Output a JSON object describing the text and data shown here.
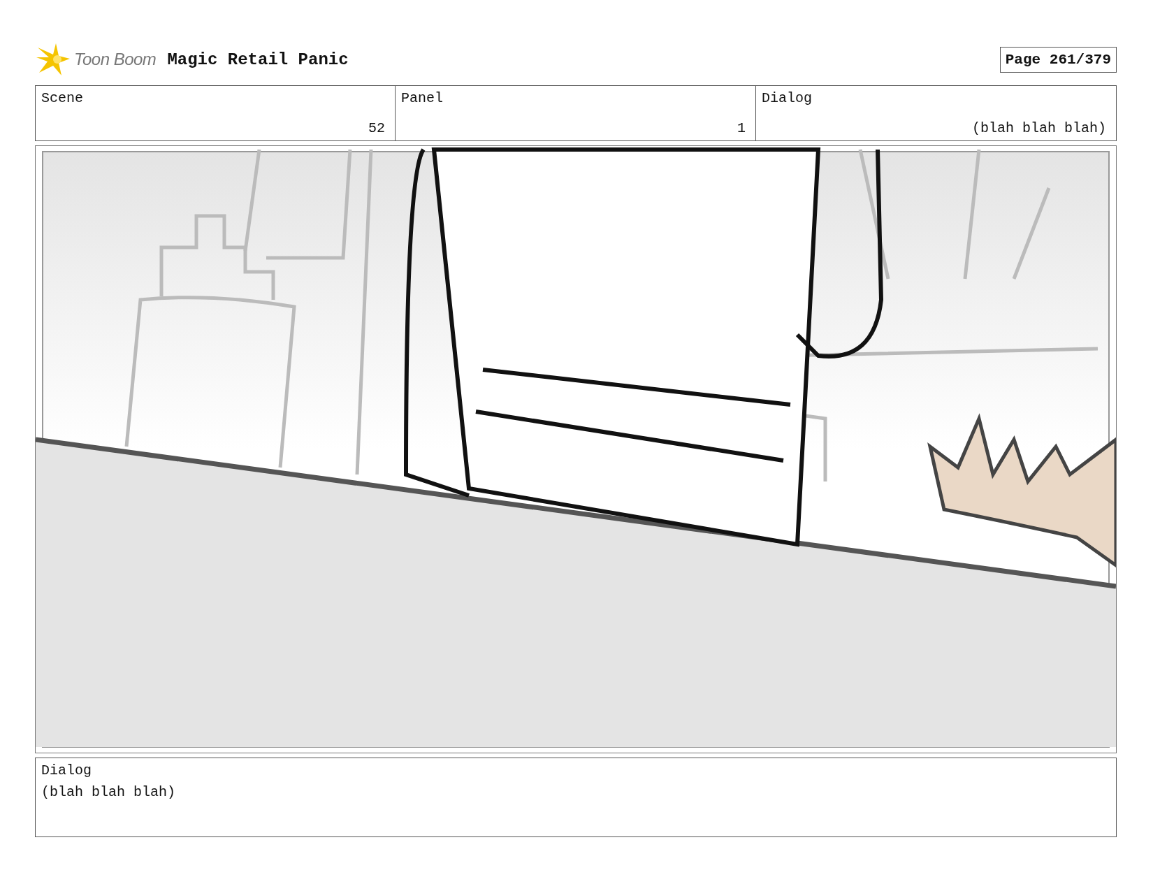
{
  "header": {
    "logo_text": "Toon Boom",
    "title": "Magic Retail Panic",
    "page": "Page 261/379"
  },
  "info": [
    {
      "label": "Scene",
      "value": "52"
    },
    {
      "label": "Panel",
      "value": "1"
    },
    {
      "label": "Dialog",
      "value": "(blah blah blah)"
    }
  ],
  "dialog": {
    "label": "Dialog",
    "text": "(blah blah blah)"
  }
}
